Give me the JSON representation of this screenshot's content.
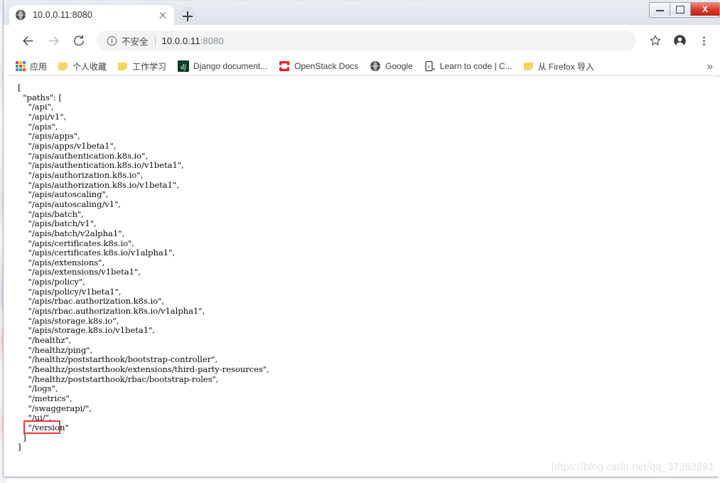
{
  "window": {
    "minimize_label": "Minimize",
    "maximize_label": "Maximize",
    "close_label": "X"
  },
  "tab": {
    "title": "10.0.0.11:8080",
    "favicon": "globe-icon",
    "close_label": "Close tab",
    "new_tab_label": "New tab"
  },
  "toolbar": {
    "back_label": "Back",
    "forward_label": "Forward",
    "reload_label": "Reload",
    "security_text": "不安全",
    "url_host": "10.0.0.11",
    "url_port": ":8080",
    "url_full": "10.0.0.11:8080",
    "bookmark_star_label": "Bookmark this page",
    "profile_label": "Profile",
    "menu_label": "Customize and control Google Chrome"
  },
  "bookmarks": {
    "items": [
      {
        "label": "应用",
        "icon": "apps-grid-icon"
      },
      {
        "label": "个人收藏",
        "icon": "folder-icon"
      },
      {
        "label": "工作学习",
        "icon": "folder-icon"
      },
      {
        "label": "Django document...",
        "icon": "django-icon"
      },
      {
        "label": "OpenStack Docs",
        "icon": "openstack-icon"
      },
      {
        "label": "Google",
        "icon": "globe-icon"
      },
      {
        "label": "Learn to code | C...",
        "icon": "codecademy-icon"
      },
      {
        "label": "从 Firefox 导入",
        "icon": "folder-icon"
      }
    ],
    "overflow_label": "»"
  },
  "page": {
    "json_text": "[\n  \"paths\": [\n    \"/api\",\n    \"/api/v1\",\n    \"/apis\",\n    \"/apis/apps\",\n    \"/apis/apps/v1beta1\",\n    \"/apis/authentication.k8s.io\",\n    \"/apis/authentication.k8s.io/v1beta1\",\n    \"/apis/authorization.k8s.io\",\n    \"/apis/authorization.k8s.io/v1beta1\",\n    \"/apis/autoscaling\",\n    \"/apis/autoscaling/v1\",\n    \"/apis/batch\",\n    \"/apis/batch/v1\",\n    \"/apis/batch/v2alpha1\",\n    \"/apis/certificates.k8s.io\",\n    \"/apis/certificates.k8s.io/v1alpha1\",\n    \"/apis/extensions\",\n    \"/apis/extensions/v1beta1\",\n    \"/apis/policy\",\n    \"/apis/policy/v1beta1\",\n    \"/apis/rbac.authorization.k8s.io\",\n    \"/apis/rbac.authorization.k8s.io/v1alpha1\",\n    \"/apis/storage.k8s.io\",\n    \"/apis/storage.k8s.io/v1beta1\",\n    \"/healthz\",\n    \"/healthz/ping\",\n    \"/healthz/poststarthook/bootstrap-controller\",\n    \"/healthz/poststarthook/extensions/third-party-resources\",\n    \"/healthz/poststarthook/rbac/bootstrap-roles\",\n    \"/logs\",\n    \"/metrics\",\n    \"/swaggerapi/\",\n    \"/ui/\",\n    \"/version\"\n  ]\n]",
    "paths": [
      "/api",
      "/api/v1",
      "/apis",
      "/apis/apps",
      "/apis/apps/v1beta1",
      "/apis/authentication.k8s.io",
      "/apis/authentication.k8s.io/v1beta1",
      "/apis/authorization.k8s.io",
      "/apis/authorization.k8s.io/v1beta1",
      "/apis/autoscaling",
      "/apis/autoscaling/v1",
      "/apis/batch",
      "/apis/batch/v1",
      "/apis/batch/v2alpha1",
      "/apis/certificates.k8s.io",
      "/apis/certificates.k8s.io/v1alpha1",
      "/apis/extensions",
      "/apis/extensions/v1beta1",
      "/apis/policy",
      "/apis/policy/v1beta1",
      "/apis/rbac.authorization.k8s.io",
      "/apis/rbac.authorization.k8s.io/v1alpha1",
      "/apis/storage.k8s.io",
      "/apis/storage.k8s.io/v1beta1",
      "/healthz",
      "/healthz/ping",
      "/healthz/poststarthook/bootstrap-controller",
      "/healthz/poststarthook/extensions/third-party-resources",
      "/healthz/poststarthook/rbac/bootstrap-roles",
      "/logs",
      "/metrics",
      "/swaggerapi/",
      "/ui/",
      "/version"
    ],
    "key_name": "paths",
    "highlighted_path": "/ui/",
    "highlight_color": "#f03434"
  },
  "watermark": {
    "text": "https://blog.csdn.net/qq_37362891"
  }
}
